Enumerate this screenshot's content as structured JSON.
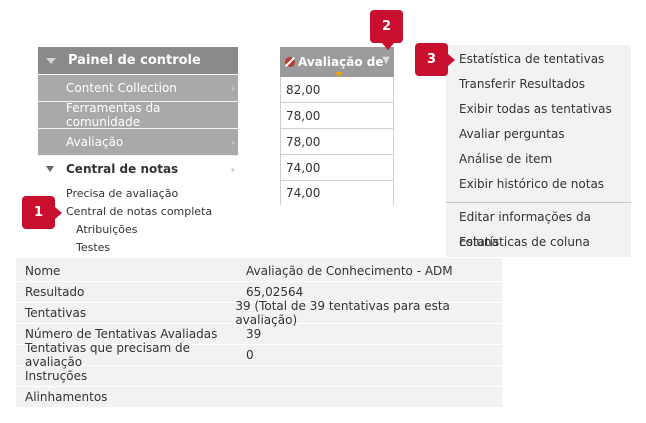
{
  "panel": {
    "title": "Painel de controle",
    "items": [
      {
        "label": "Content Collection",
        "has_submenu": true
      },
      {
        "label": "Ferramentas da comunidade",
        "has_submenu": false
      },
      {
        "label": "Avaliação",
        "has_submenu": true
      }
    ],
    "open_section": {
      "label": "Central de notas",
      "children": [
        {
          "label": "Precisa de avaliação"
        },
        {
          "label": "Central de notas completa"
        },
        {
          "label": "Atribuições"
        },
        {
          "label": "Testes"
        }
      ]
    }
  },
  "grade_column": {
    "header": "Avaliação de",
    "values": [
      "82,00",
      "78,00",
      "78,00",
      "74,00",
      "74,00"
    ]
  },
  "context_menu": {
    "items": [
      "Estatística de tentativas",
      "Transferir Resultados",
      "Exibir todas as tentativas",
      "Avaliar perguntas",
      "Análise de item",
      "Exibir histórico de notas"
    ],
    "items_after_separator": [
      "Editar informações da coluna",
      "Estatísticas de coluna"
    ]
  },
  "info": {
    "rows": [
      {
        "key": "Nome",
        "value": "Avaliação de Conhecimento - ADM"
      },
      {
        "key": "Resultado",
        "value": "65,02564"
      },
      {
        "key": "Tentativas",
        "value": "39 (Total de 39 tentativas para esta avaliação)"
      },
      {
        "key": "Número de Tentativas Avaliadas",
        "value": "39"
      },
      {
        "key": "Tentativas que precisam de avaliação",
        "value": "0"
      },
      {
        "key": "Instruções",
        "value": ""
      },
      {
        "key": "Alinhamentos",
        "value": ""
      }
    ]
  },
  "callouts": [
    "1",
    "2",
    "3"
  ],
  "colors": {
    "callout": "#c8102e",
    "panel_header": "#8a8a8a",
    "panel_item": "#a9a9a9",
    "menu_bg": "#f2f2f2"
  }
}
